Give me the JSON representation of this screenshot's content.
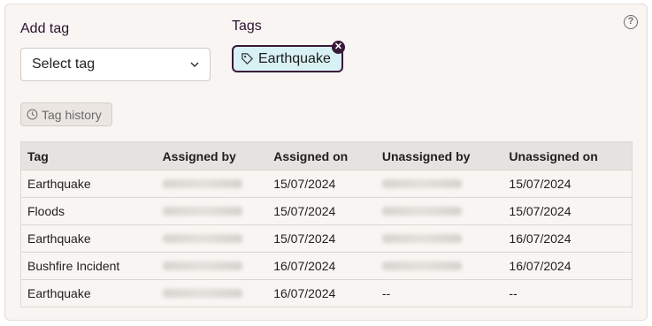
{
  "add_tag": {
    "label": "Add tag",
    "placeholder": "Select tag"
  },
  "tags": {
    "label": "Tags",
    "chips": [
      "Earthquake"
    ]
  },
  "history_button": {
    "label": "Tag history"
  },
  "table": {
    "columns": [
      "Tag",
      "Assigned by",
      "Assigned on",
      "Unassigned by",
      "Unassigned on"
    ],
    "rows": [
      {
        "tag": "Earthquake",
        "assigned_on": "15/07/2024",
        "unassigned_on": "15/07/2024"
      },
      {
        "tag": "Floods",
        "assigned_on": "15/07/2024",
        "unassigned_on": "15/07/2024"
      },
      {
        "tag": "Earthquake",
        "assigned_on": "15/07/2024",
        "unassigned_on": "16/07/2024"
      },
      {
        "tag": "Bushfire Incident",
        "assigned_on": "16/07/2024",
        "unassigned_on": "16/07/2024"
      },
      {
        "tag": "Earthquake",
        "assigned_on": "16/07/2024",
        "unassigned_by": "--",
        "unassigned_on": "--"
      }
    ]
  },
  "colors": {
    "accent_dark": "#3a1838",
    "chip_bg": "#d8f1f4",
    "panel_bg": "#f8f5f2"
  }
}
